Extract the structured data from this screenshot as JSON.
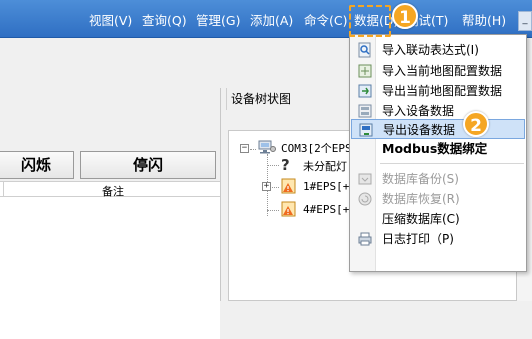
{
  "menubar": {
    "items": [
      "视图(V)",
      "查询(Q)",
      "管理(G)",
      "添加(A)",
      "命令(C)",
      "数据(D)",
      "测试(T)",
      "帮助(H)"
    ],
    "minimize": "_"
  },
  "left_panel": {
    "flash_button": "闪烁",
    "stop_flash_button": "停闪",
    "notes_header": "备注"
  },
  "tree": {
    "title": "设备树状图",
    "nodes": [
      "COM3[2个EPS-",
      "未分配灯",
      "1#EPS[+]",
      "4#EPS[+]"
    ]
  },
  "dropdown": {
    "items": [
      {
        "label": "导入联动表达式(I)",
        "icon": "import-expression-icon",
        "enabled": true
      },
      {
        "label": "导入当前地图配置数据",
        "icon": "import-map-icon",
        "enabled": true
      },
      {
        "label": "导出当前地图配置数据",
        "icon": "export-map-icon",
        "enabled": true
      },
      {
        "label": "导入设备数据",
        "icon": "import-device-icon",
        "enabled": true
      },
      {
        "label": "导出设备数据",
        "icon": "export-device-icon",
        "enabled": true,
        "highlighted": true
      },
      {
        "label": "Modbus数据绑定",
        "icon": "",
        "enabled": true
      },
      {
        "label": "数据库备份(S)",
        "icon": "database-backup-icon",
        "enabled": false
      },
      {
        "label": "数据库恢复(R)",
        "icon": "database-restore-icon",
        "enabled": false
      },
      {
        "label": "压缩数据库(C)",
        "icon": "",
        "enabled": true
      },
      {
        "label": "日志打印（P)",
        "icon": "printer-icon",
        "enabled": true
      }
    ]
  },
  "annotations": {
    "step1": "1",
    "step2": "2",
    "accent": "#f5a623"
  },
  "colors": {
    "menubar": "#3a7bd0",
    "highlight": "#cfe2f8"
  }
}
